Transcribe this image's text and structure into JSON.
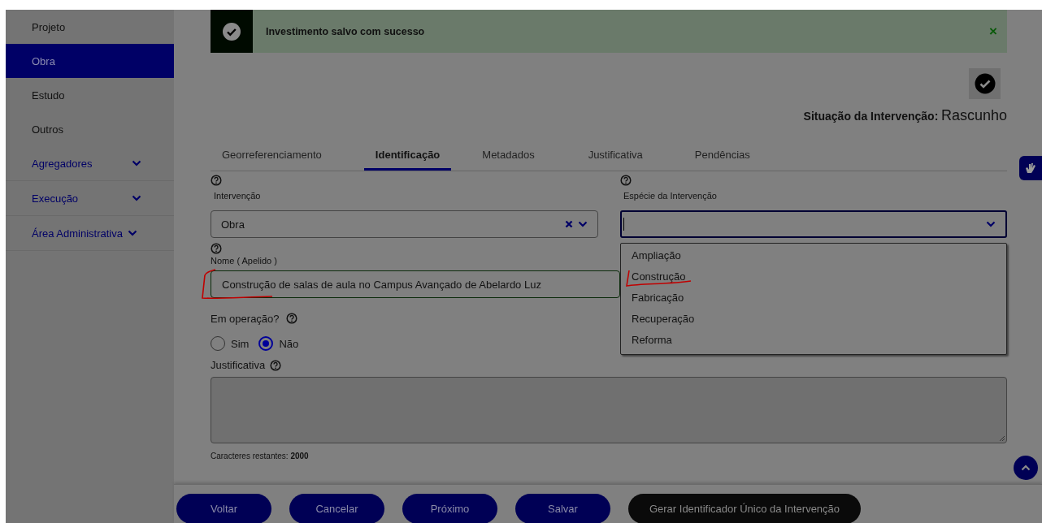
{
  "sidebar": {
    "items": [
      {
        "label": "Projeto",
        "kind": "link",
        "selected": false
      },
      {
        "label": "Obra",
        "kind": "link",
        "selected": true
      },
      {
        "label": "Estudo",
        "kind": "link",
        "selected": false
      },
      {
        "label": "Outros",
        "kind": "link",
        "selected": false
      },
      {
        "label": "Agregadores",
        "kind": "group",
        "selected": false
      },
      {
        "label": "Execução",
        "kind": "group",
        "selected": false
      },
      {
        "label": "Área Administrativa",
        "kind": "group",
        "selected": false
      }
    ]
  },
  "toast": {
    "message": "Investimento salvo com sucesso",
    "close": "×"
  },
  "status": {
    "label": "Situação da Intervenção:",
    "value": "Rascunho"
  },
  "tabs": [
    {
      "label": "Georreferenciamento",
      "selected": false
    },
    {
      "label": "Identificação",
      "selected": true
    },
    {
      "label": "Metadados",
      "selected": false
    },
    {
      "label": "Justificativa",
      "selected": false
    },
    {
      "label": "Pendências",
      "selected": false
    }
  ],
  "intervencao": {
    "label": "Intervenção",
    "value": "Obra"
  },
  "especie": {
    "label": "Espécie da Intervenção",
    "expanded": true,
    "options": [
      {
        "label": "Ampliação",
        "annotated": false
      },
      {
        "label": "Construção",
        "annotated": true
      },
      {
        "label": "Fabricação",
        "annotated": false
      },
      {
        "label": "Recuperação",
        "annotated": false
      },
      {
        "label": "Reforma",
        "annotated": false
      }
    ]
  },
  "nome": {
    "label": "Nome ( Apelido )",
    "value": "Construção de salas de aula no Campus Avançado de Abelardo Luz",
    "annotated": true
  },
  "em_operacao": {
    "label": "Em operação?",
    "options": [
      {
        "label": "Sim",
        "selected": false
      },
      {
        "label": "Não",
        "selected": true
      }
    ]
  },
  "justificativa": {
    "label": "Justificativa",
    "counter": "Caracteres restantes: **2000**"
  },
  "buttons": [
    {
      "label": "Voltar",
      "kind": "primary"
    },
    {
      "label": "Cancelar",
      "kind": "primary"
    },
    {
      "label": "Próximo",
      "kind": "primary"
    },
    {
      "label": "Salvar",
      "kind": "primary"
    },
    {
      "label": "Gerar Identificador Único da Intervenção",
      "kind": "dark"
    }
  ]
}
